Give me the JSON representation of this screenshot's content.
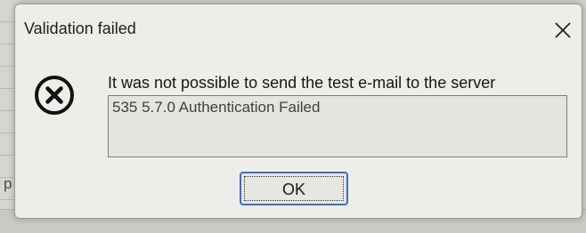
{
  "dialog": {
    "title": "Validation failed",
    "close_icon": "close-icon",
    "status_icon": "error-circle-x-icon",
    "message": "It was not possible to send the test e-mail to the server",
    "details": "535 5.7.0 Authentication Failed",
    "ok_label": "OK"
  },
  "background": {
    "partial_text": "p"
  },
  "colors": {
    "dialog_bg": "#ededea",
    "button_focus_border": "#3c6fc0",
    "icon": "#111111"
  }
}
